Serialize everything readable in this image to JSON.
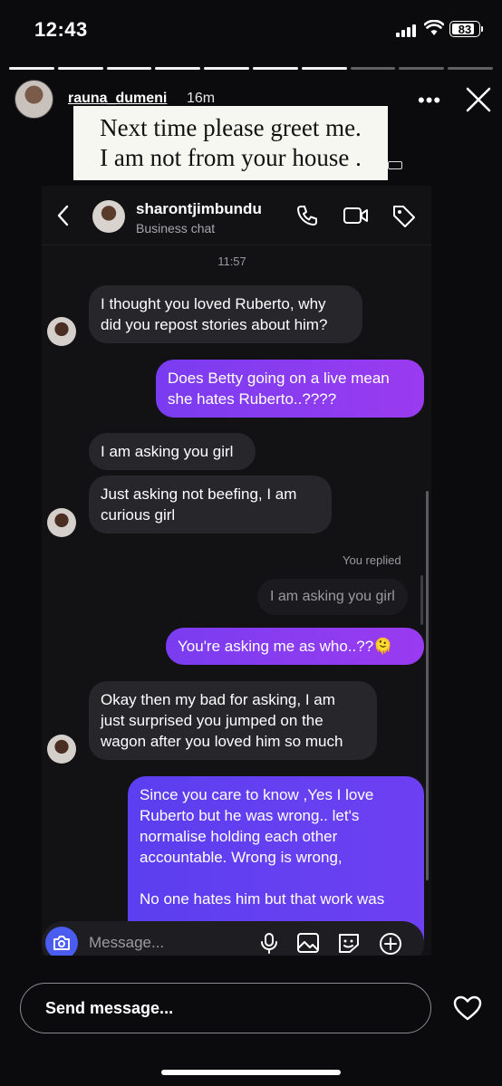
{
  "status_bar": {
    "time": "12:43",
    "battery": "83"
  },
  "story": {
    "username": "rauna_dumeni",
    "age": "16m",
    "caption_line1": "Next time please greet me.",
    "caption_line2": "I am not from your house ."
  },
  "chat": {
    "contact_name": "sharontjimbundu",
    "contact_subtitle": "Business chat",
    "timestamp": "11:57",
    "messages": [
      {
        "from": "them",
        "text_lines": [
          "I thought you loved Ruberto, why",
          "did you repost stories about him?"
        ]
      },
      {
        "from": "me",
        "text_lines": [
          "Does Betty going on a live mean",
          "she hates Ruberto..????"
        ]
      },
      {
        "from": "them",
        "text_lines": [
          "I am asking you girl"
        ]
      },
      {
        "from": "them",
        "text_lines": [
          "Just asking not beefing, I am",
          "curious girl"
        ]
      },
      {
        "from": "me",
        "text_lines": [
          "You're asking me as who..??🫠"
        ]
      },
      {
        "from": "them",
        "text_lines": [
          "Okay then my bad for asking, I am",
          "just surprised you jumped on the",
          "wagon after you loved him so much"
        ]
      },
      {
        "from": "me",
        "text_lines": [
          "Since you care to know ,Yes I love",
          "Ruberto but he was wrong.. let's",
          "normalise holding each other",
          "accountable. Wrong is wrong,",
          "",
          "No one hates him but that work was"
        ]
      }
    ],
    "you_replied_label": "You replied",
    "replied_quote": "I am asking you girl",
    "composer_placeholder": "Message..."
  },
  "reply_bar": {
    "placeholder": "Send message..."
  }
}
